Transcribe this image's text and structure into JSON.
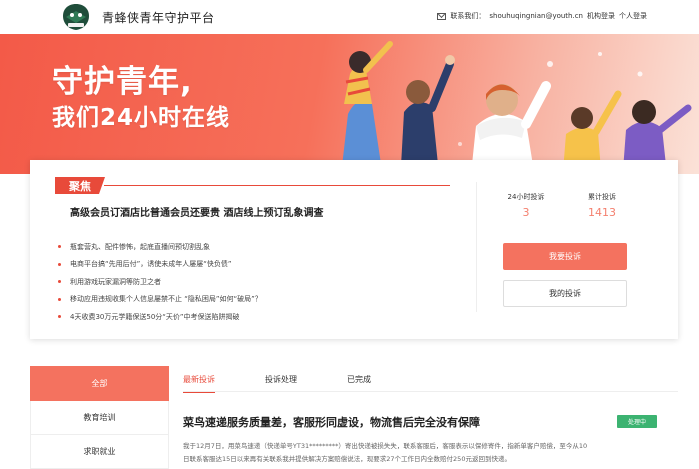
{
  "header": {
    "site_name": "青蜂侠青年守护平台",
    "logo_icon": "qingfengxia-logo",
    "contact_label": "联系我们：",
    "contact_email": "shouhuqingnian@youth.cn",
    "org_login": "机构登录",
    "personal_login": "个人登录"
  },
  "banner": {
    "line1": "守护青年,",
    "line2": "我们24小时在线"
  },
  "focus": {
    "tag": "聚焦",
    "headline": "高级会员订酒店比普通会员还要贵 酒店线上预订乱象调查",
    "items": [
      "瓶套营丸、配件惨怖，起底直播间预切割乱象",
      "电商平台搞“先用后付”，诱使未成年人屡屡“快负债”",
      "利用游戏玩家漏洞等防卫之者",
      "移动应用违规收集个人信息屡禁不止 “隐私困局”如何“破局”？",
      "4天收费30万元学籍保送50分“天价”中考保送陷阱揭破"
    ],
    "stats": [
      {
        "label": "24小时投诉",
        "value": "3"
      },
      {
        "label": "累计投诉",
        "value": "1413"
      }
    ],
    "primary_button": "我要投诉",
    "secondary_button": "我的投诉"
  },
  "categories": [
    "全部",
    "教育培训",
    "求职就业"
  ],
  "tabs": [
    "最新投诉",
    "投诉处理",
    "已完成"
  ],
  "complaint": {
    "title": "菜鸟速递服务质量差，客服形同虚设，物流售后完全没有保障",
    "status": "处理中",
    "body_line1": "我于12月7日，用菜鸟速递（快递单号YT31*********）寄出快递被损失失，联系客服后，客服表示以保修寄件，指新单客户赔偿，至今从10",
    "body_line2": "日联系客服达15日以来再有关联系我并提供解决方案赔偿说法，现要求27个工作日内全数赔付250元返回到快递。"
  },
  "colors": {
    "accent": "#f4725f",
    "brand_red": "#e84a3a",
    "status_green": "#3cb371",
    "stat_value": "#f4806f"
  }
}
